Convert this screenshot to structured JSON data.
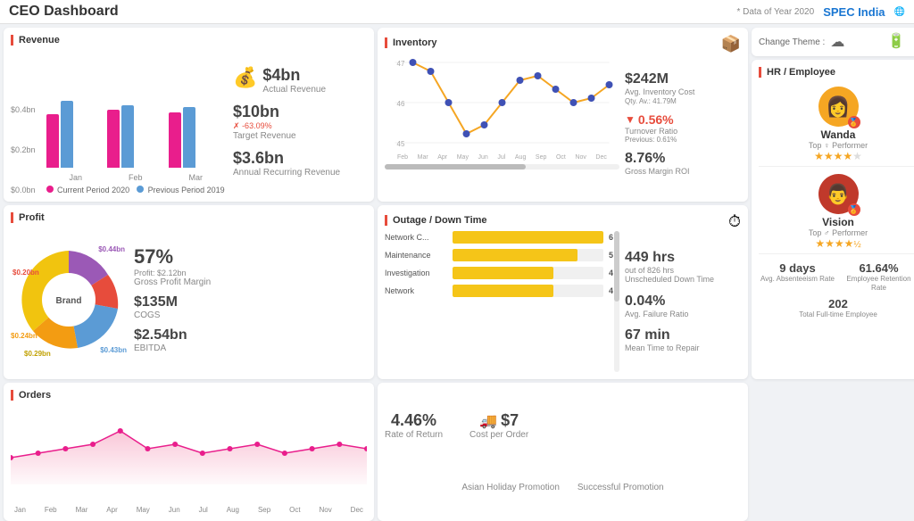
{
  "header": {
    "title": "CEO Dashboard",
    "data_note": "* Data of Year 2020",
    "logo": "SPEC India",
    "theme_label": "Change Theme :",
    "theme_icon": "☁"
  },
  "revenue": {
    "title": "Revenue",
    "actual_value": "$4bn",
    "actual_label": "Actual Revenue",
    "target_value": "$10bn",
    "target_label": "Target Revenue",
    "target_change": "-63.09%",
    "arr_value": "$3.6bn",
    "arr_label": "Annual Recurring Revenue",
    "y_labels": [
      "$0.4bn",
      "$0.2bn",
      "$0.0bn"
    ],
    "x_labels": [
      "Jan",
      "Feb",
      "Mar"
    ],
    "legend": {
      "current": "Current Period 2020",
      "previous": "Previous Period 2019"
    },
    "bars": {
      "jan": {
        "current": 60,
        "previous": 75
      },
      "feb": {
        "current": 65,
        "previous": 70
      },
      "mar": {
        "current": 62,
        "previous": 68
      }
    }
  },
  "inventory": {
    "title": "Inventory",
    "cost_value": "$242M",
    "cost_label": "Avg. Inventory Cost",
    "cost_sub": "Qty. Av.: 41.79M",
    "turnover_value": "▼ 0.56%",
    "turnover_label": "Turnover Ratio",
    "turnover_prev": "Previous: 0.61%",
    "gross_value": "8.76%",
    "gross_label": "Gross Margin ROI",
    "chart_y_max": 47,
    "chart_y_min": 45,
    "x_labels": [
      "Feb",
      "Mar",
      "Apr",
      "May",
      "Jun",
      "Jul",
      "Aug",
      "Sep",
      "Oct",
      "Nov",
      "Dec"
    ]
  },
  "profit": {
    "title": "Profit",
    "margin_pct": "57%",
    "margin_label": "Gross Profit Margin",
    "margin_sub": "Profit: $2.12bn",
    "cogs_value": "$135M",
    "cogs_label": "COGS",
    "ebitda_value": "$2.54bn",
    "ebitda_label": "EBITDA",
    "donut_center": "Brand",
    "segments": [
      {
        "label": "$0.44bn",
        "color": "#9b59b6",
        "pct": 28
      },
      {
        "label": "$0.20bn",
        "color": "#e74c3c",
        "pct": 13
      },
      {
        "label": "$0.43bn",
        "color": "#5b9bd5",
        "pct": 27
      },
      {
        "label": "$0.24bn",
        "color": "#f39c12",
        "pct": 15
      },
      {
        "label": "$0.29bn",
        "color": "#f1c40f",
        "pct": 17
      }
    ]
  },
  "outage": {
    "title": "Outage / Down Time",
    "unscheduled_val": "449 hrs",
    "unscheduled_sub": "out of 826 hrs",
    "unscheduled_label": "Unscheduled Down Time",
    "failure_val": "0.04%",
    "failure_label": "Avg. Failure Ratio",
    "repair_val": "67 min",
    "repair_label": "Mean Time to Repair",
    "bars": [
      {
        "label": "Network C...",
        "count": 6,
        "pct": 100
      },
      {
        "label": "Maintenance",
        "count": 5,
        "pct": 83
      },
      {
        "label": "Investigation",
        "count": 4,
        "pct": 67
      },
      {
        "label": "Network",
        "count": 4,
        "pct": 67
      }
    ]
  },
  "hr": {
    "title": "HR / Employee",
    "emp1": {
      "name": "Wanda",
      "role": "Top ♀ Performer",
      "stars": 4,
      "total_stars": 5
    },
    "emp2": {
      "name": "Vision",
      "role": "Top ♂ Performer",
      "stars": 4.5,
      "total_stars": 5
    },
    "absenteeism_val": "9 days",
    "absenteeism_label": "Avg. Absenteeism Rate",
    "retention_val": "61.64%",
    "retention_label": "Employee Retention Rate",
    "fulltime_val": "202",
    "fulltime_label": "Total Full-time Employee"
  },
  "orders": {
    "title": "Orders",
    "x_labels": [
      "Jan",
      "Feb",
      "Mar",
      "Apr",
      "May",
      "Jun",
      "Jul",
      "Aug",
      "Sep",
      "Oct",
      "Nov",
      "Dec"
    ],
    "return_rate": "4.46%",
    "return_label": "Rate of Return",
    "cost_per_order": "$7",
    "cost_label": "Cost per Order",
    "promo1": "Asian Holiday Promotion",
    "promo2": "Successful Promotion"
  }
}
